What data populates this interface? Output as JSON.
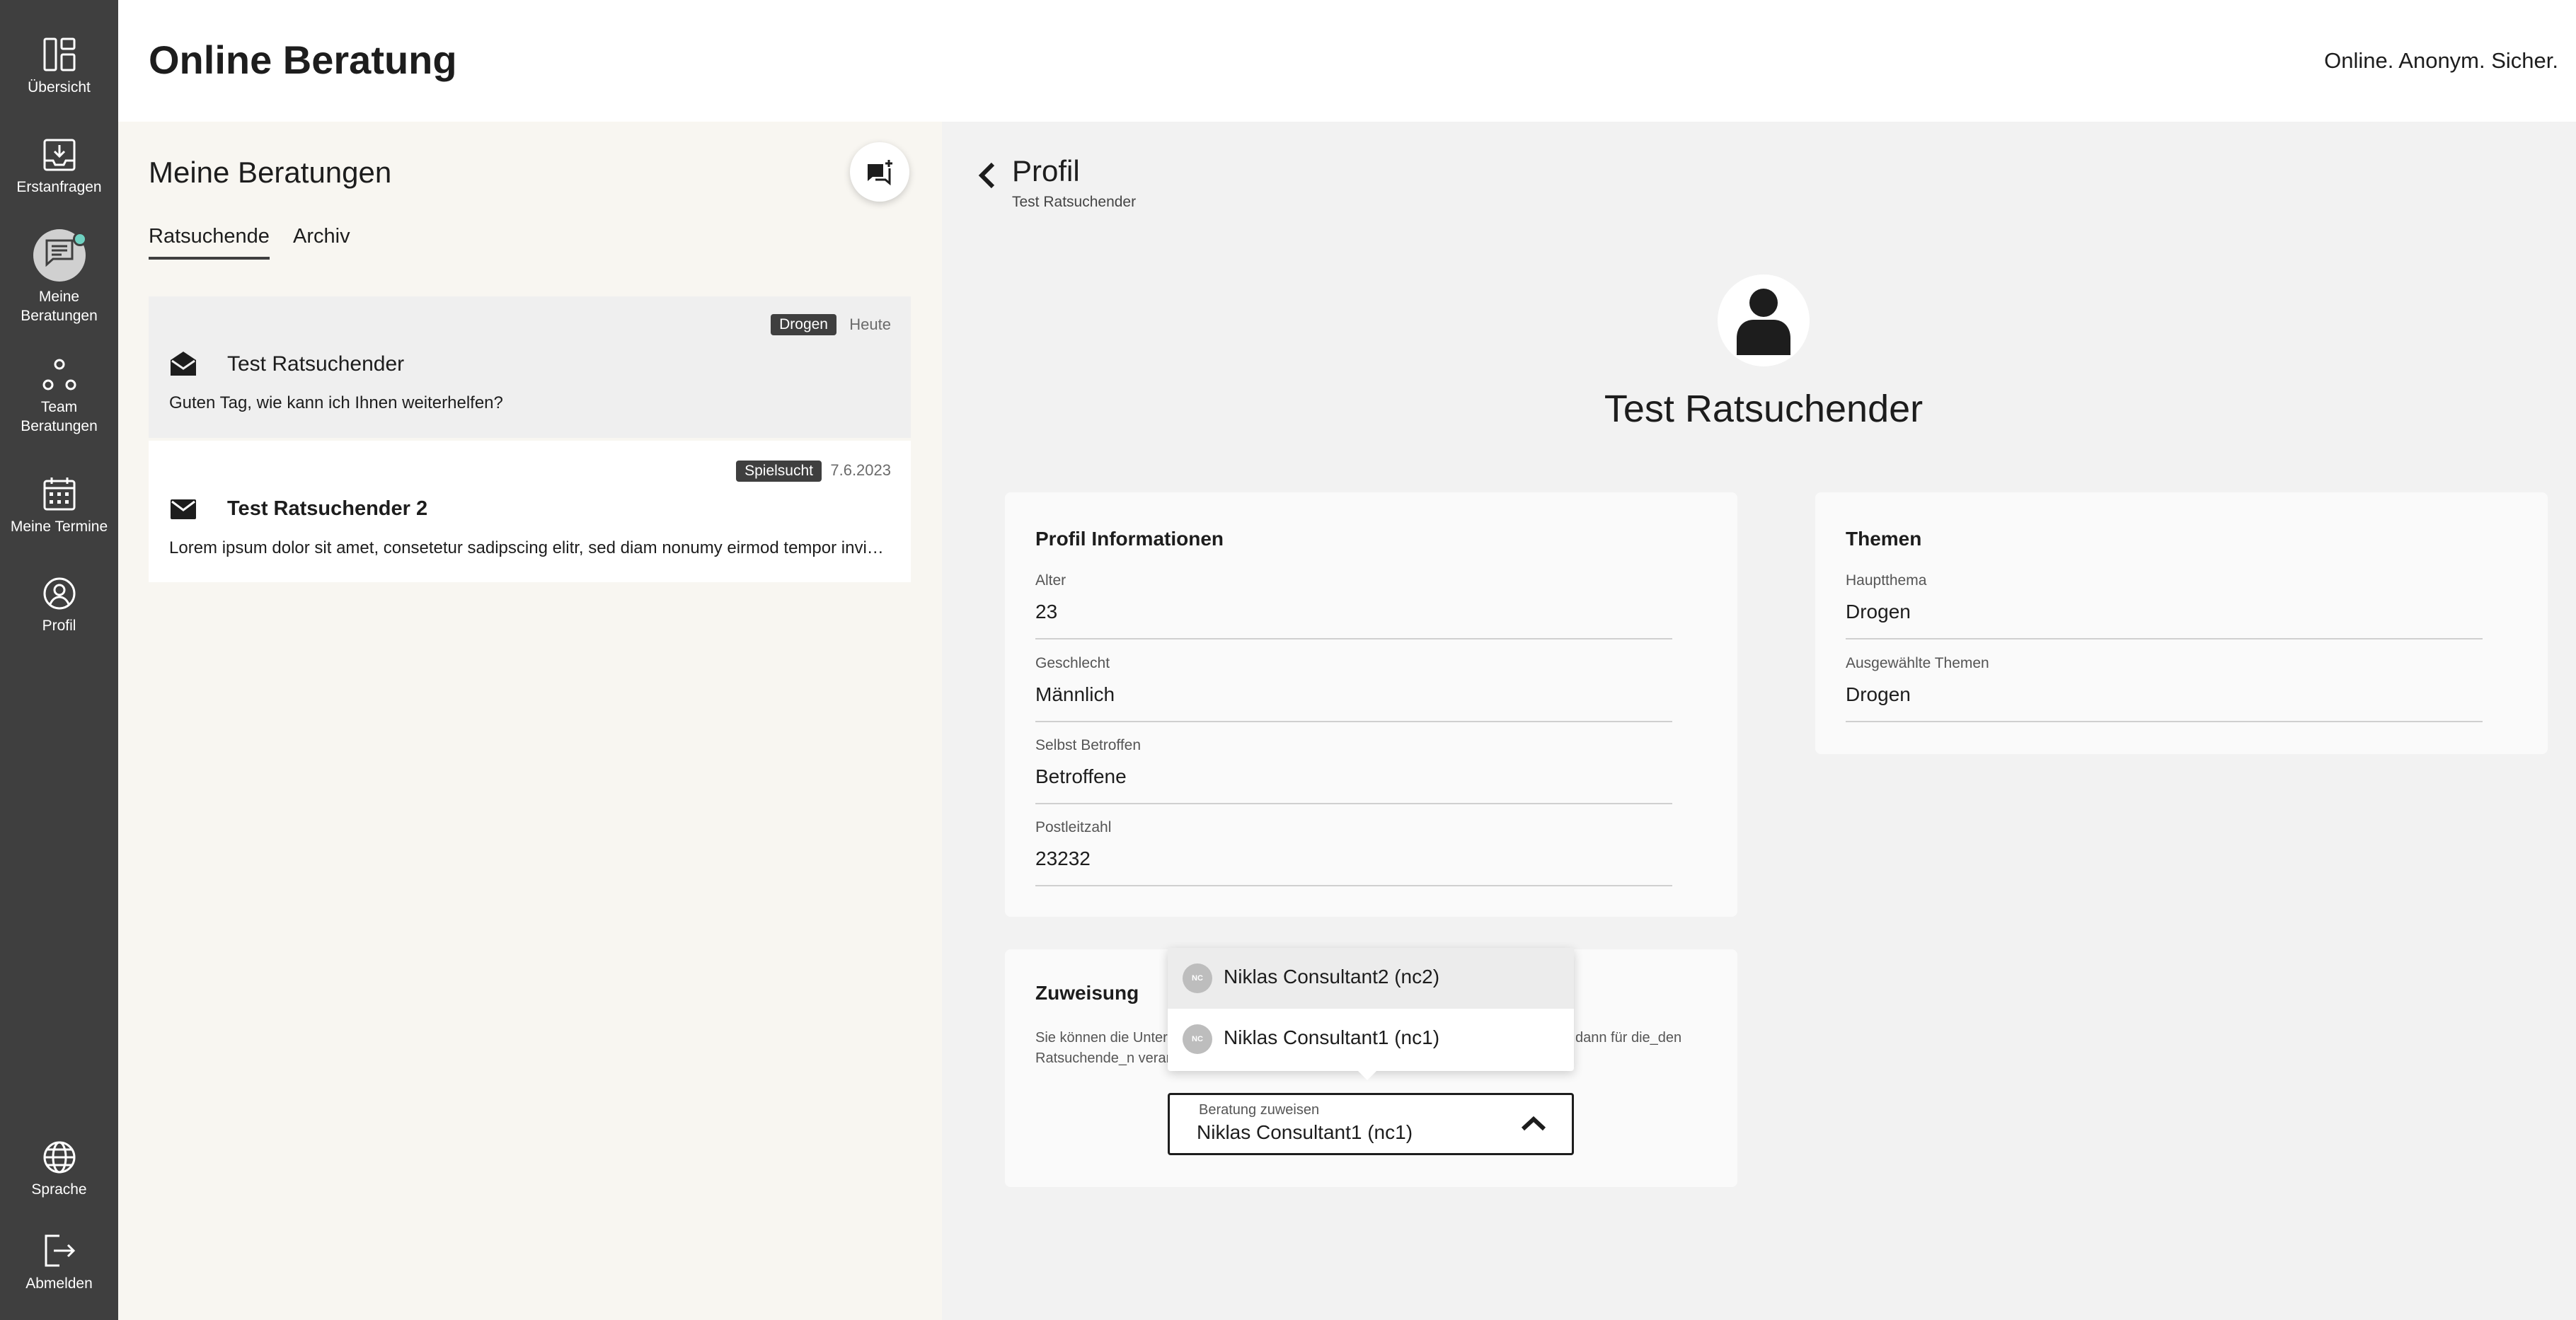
{
  "app": {
    "title": "Online Beratung",
    "claim": "Online. Anonym. Sicher."
  },
  "sidebar": {
    "items": [
      {
        "label": "Übersicht",
        "icon": "overview-icon"
      },
      {
        "label": "Erstanfragen",
        "icon": "inbox-icon"
      },
      {
        "label": "Meine\nBeratungen",
        "icon": "chat-icon",
        "active": true
      },
      {
        "label": "Team\nBeratungen",
        "icon": "team-icon"
      },
      {
        "label": "Meine Termine",
        "icon": "calendar-icon"
      },
      {
        "label": "Profil",
        "icon": "profile-icon"
      }
    ],
    "bottom": [
      {
        "label": "Sprache",
        "icon": "globe-icon"
      },
      {
        "label": "Abmelden",
        "icon": "logout-icon"
      }
    ]
  },
  "list": {
    "title": "Meine Beratungen",
    "tabs": [
      {
        "label": "Ratsuchende",
        "active": true
      },
      {
        "label": "Archiv"
      }
    ],
    "sessions": [
      {
        "name": "Test Ratsuchender",
        "message": "Guten Tag, wie kann ich Ihnen weiterhelfen?",
        "tag": "Drogen",
        "date": "Heute",
        "icon": "envelope-open-icon"
      },
      {
        "name": "Test Ratsuchender 2",
        "message": "Lorem ipsum dolor sit amet, consetetur sadipscing elitr, sed diam nonumy eirmod tempor invidunt ut labore et dolore magna aliquyam",
        "tag": "Spielsucht",
        "date": "7.6.2023",
        "icon": "envelope-icon"
      }
    ]
  },
  "profile": {
    "heading": "Profil",
    "subheading": "Test Ratsuchender",
    "name": "Test Ratsuchender",
    "info": {
      "title": "Profil Informationen",
      "fields": [
        {
          "label": "Alter",
          "value": "23"
        },
        {
          "label": "Geschlecht",
          "value": "Männlich"
        },
        {
          "label": "Selbst Betroffen",
          "value": "Betroffene"
        },
        {
          "label": "Postleitzahl",
          "value": "23232"
        }
      ]
    },
    "themen": {
      "title": "Themen",
      "fields": [
        {
          "label": "Hauptthema",
          "value": "Drogen"
        },
        {
          "label": "Ausgewählte Themen",
          "value": "Drogen"
        }
      ]
    },
    "assign": {
      "title": "Zuweisung",
      "text_left_1": "Sie können die Unter",
      "text_left_2": "Ratsuchende_n veran",
      "text_right": "dann für die_den",
      "select_label": "Beratung zuweisen",
      "select_value": "Niklas Consultant1 (nc1)",
      "options": [
        {
          "initials": "NC",
          "label": "Niklas Consultant2 (nc2)",
          "highlighted": true
        },
        {
          "initials": "NC",
          "label": "Niklas Consultant1 (nc1)"
        }
      ]
    }
  }
}
